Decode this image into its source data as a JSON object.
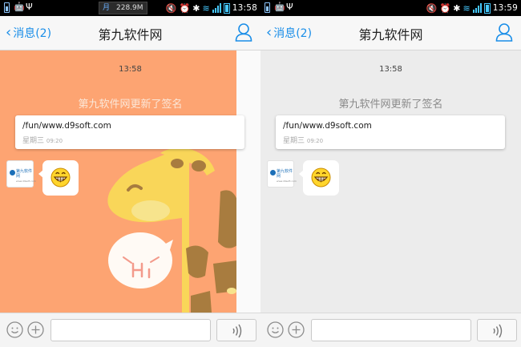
{
  "left": {
    "statusbar": {
      "chip_icon": "月",
      "memory": "228.9M",
      "clock": "13:58"
    },
    "nav": {
      "back_label": "消息(2)",
      "title": "第九软件网"
    },
    "chat": {
      "time": "13:58",
      "system_message": "第九软件网更新了签名",
      "card_url": "/fun/www.d9soft.com",
      "card_day": "星期三",
      "card_time": "09:20",
      "avatar_text": "第九软件网",
      "avatar_sub": "www.d9soft.com",
      "sticker_text": "Hi"
    }
  },
  "right": {
    "statusbar": {
      "clock": "13:59"
    },
    "nav": {
      "back_label": "消息(2)",
      "title": "第九软件网"
    },
    "chat": {
      "time": "13:58",
      "system_message": "第九软件网更新了签名",
      "card_url": "/fun/www.d9soft.com",
      "card_day": "星期三",
      "card_time": "09:20",
      "avatar_text": "第九软件网",
      "avatar_sub": "www.d9soft.com"
    }
  },
  "icons": {
    "back": "chevron-left-icon",
    "profile": "person-icon",
    "emoji": "smiley-face-icon",
    "plus": "plus-icon",
    "voice": "voice-wave-icon"
  },
  "colors": {
    "accent": "#1a8ee8",
    "chat_bg_orange": "#fda472",
    "chat_bg_gray": "#ececec",
    "giraffe_yellow": "#f9d659",
    "giraffe_spot": "#a87c3f"
  }
}
